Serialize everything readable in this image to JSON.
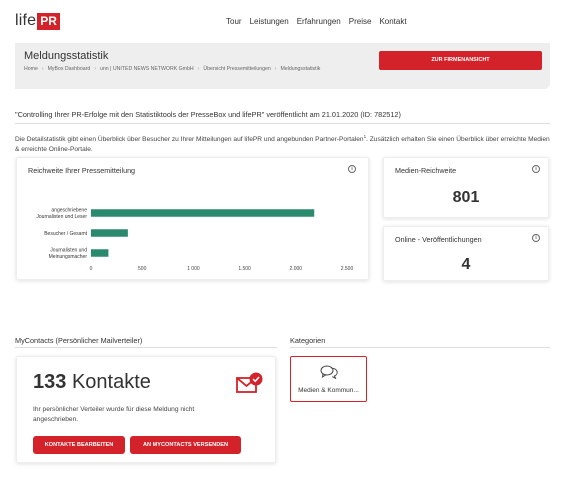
{
  "logo": {
    "text": "life",
    "box": "PR"
  },
  "nav": {
    "items": [
      "Tour",
      "Leistungen",
      "Erfahrungen",
      "Preise",
      "Kontakt"
    ]
  },
  "header": {
    "title": "Meldungsstatistik",
    "breadcrumb": [
      "Home",
      "MyBox Dashboard",
      "unn | UNITED NEWS NETWORK GmbH",
      "Übersicht Pressemitteilungen",
      "Meldungsstatistik"
    ],
    "firm_button": "ZUR FIRMENANSICHT"
  },
  "release": {
    "title": "\"Controlling Ihrer PR-Erfolge mit den Statistiktools der PresseBox und lifePR\" veröffentlicht am 21.01.2020 (ID: 782512)",
    "intro_part1": "Die Detailstatistik gibt einen Überblick über Besucher zu Ihrer Mitteilungen auf lifePR und angebunden Partner-Portalen",
    "intro_sup": "1",
    "intro_part2": ". Zusätzlich erhalten Sie einen Überblick über erreichte Medien & erreichte Online-Portale."
  },
  "reach_card": {
    "title": "Reichweite Ihrer Pressemitteilung",
    "info": "i"
  },
  "chart_data": {
    "type": "bar",
    "orientation": "horizontal",
    "categories": [
      "angeschriebene Journalisten und Leser",
      "Besucher / Gesamt",
      "Journalisten und Meinungsmacher"
    ],
    "category_lines": [
      [
        "angeschriebene",
        "Journalisten und Leser"
      ],
      [
        "Besucher / Gesamt"
      ],
      [
        "Journalisten und",
        "Meinungsmacher"
      ]
    ],
    "values": [
      2180,
      360,
      170
    ],
    "xlim": [
      0,
      2500
    ],
    "xticks": [
      0,
      500,
      1000,
      1500,
      2000,
      2500
    ],
    "xtick_labels": [
      "0",
      "500",
      "1 000",
      "1.500",
      "2.000",
      "2.500"
    ],
    "color": "#2a8a6e",
    "grid": false
  },
  "stats": {
    "media_title": "Medien-Reichweite",
    "media_value": "801",
    "online_title": "Online - Veröffentlichungen",
    "online_value": "4"
  },
  "contacts": {
    "section_title": "MyContacts (Persönlicher Mailverteiler)",
    "count": "133",
    "count_label": "Kontakte",
    "description": "Ihr persönlicher Verteiler wurde für diese Meldung nicht angeschrieben.",
    "edit_button": "KONTAKTE BEARBEITEN",
    "send_button": "AN MYCONTACTS VERSENDEN",
    "icon": "mail-check-icon"
  },
  "categories": {
    "section_title": "Kategorien",
    "items": [
      {
        "label": "Medien & Kommun...",
        "icon": "chat-bubbles-icon"
      }
    ]
  },
  "colors": {
    "accent": "#d3222a",
    "bar": "#2a8a6e",
    "panel": "#eeeeee"
  }
}
